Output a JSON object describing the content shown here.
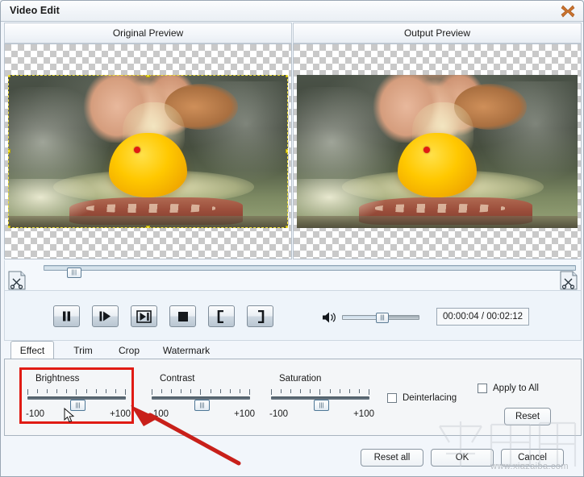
{
  "window": {
    "title": "Video Edit",
    "close_icon": "close-x-icon"
  },
  "previews": {
    "original_label": "Original Preview",
    "output_label": "Output Preview",
    "scene_description": "egg cracked into frying pan",
    "selection_marker_color": "#f2e23a",
    "red_dot_color": "#e01b14"
  },
  "timeline": {
    "start_trim_icon": "scissors-start-icon",
    "end_trim_icon": "scissors-end-icon",
    "thumb_glyph": "|||",
    "position_percent": 3
  },
  "transport": {
    "buttons": [
      {
        "name": "pause-button",
        "glyph": "pause"
      },
      {
        "name": "play-forward-button",
        "glyph": "play-bar"
      },
      {
        "name": "next-frame-button",
        "glyph": "frame-step"
      },
      {
        "name": "stop-button",
        "glyph": "stop"
      },
      {
        "name": "mark-in-button",
        "glyph": "["
      },
      {
        "name": "mark-out-button",
        "glyph": "]"
      }
    ],
    "volume_icon": "speaker-icon",
    "volume_percent": 50,
    "volume_thumb_glyph": "|||",
    "time_display": "00:00:04 / 00:02:12",
    "current_time": "00:00:04",
    "total_time": "00:02:12"
  },
  "tabs": [
    {
      "label": "Effect",
      "active": true
    },
    {
      "label": "Trim",
      "active": false
    },
    {
      "label": "Crop",
      "active": false
    },
    {
      "label": "Watermark",
      "active": false
    }
  ],
  "effect_panel": {
    "sliders": [
      {
        "name": "brightness",
        "label": "Brightness",
        "min_label": "-100",
        "max_label": "+100",
        "value": 0,
        "highlighted": true
      },
      {
        "name": "contrast",
        "label": "Contrast",
        "min_label": "-100",
        "max_label": "+100",
        "value": 0,
        "highlighted": false
      },
      {
        "name": "saturation",
        "label": "Saturation",
        "min_label": "-100",
        "max_label": "+100",
        "value": 0,
        "highlighted": false
      }
    ],
    "thumb_glyph": "|||",
    "deinterlacing": {
      "label": "Deinterlacing",
      "checked": false
    },
    "apply_to_all": {
      "label": "Apply to All",
      "checked": false
    },
    "reset_label": "Reset",
    "highlight_color": "#e01b14"
  },
  "footer": {
    "reset_all_label": "Reset all",
    "ok_label": "OK",
    "cancel_label": "Cancel"
  },
  "annotation": {
    "arrow_color": "#c8201a",
    "points_to": "brightness"
  },
  "watermark": {
    "url": "www.xiazaiba.com"
  }
}
